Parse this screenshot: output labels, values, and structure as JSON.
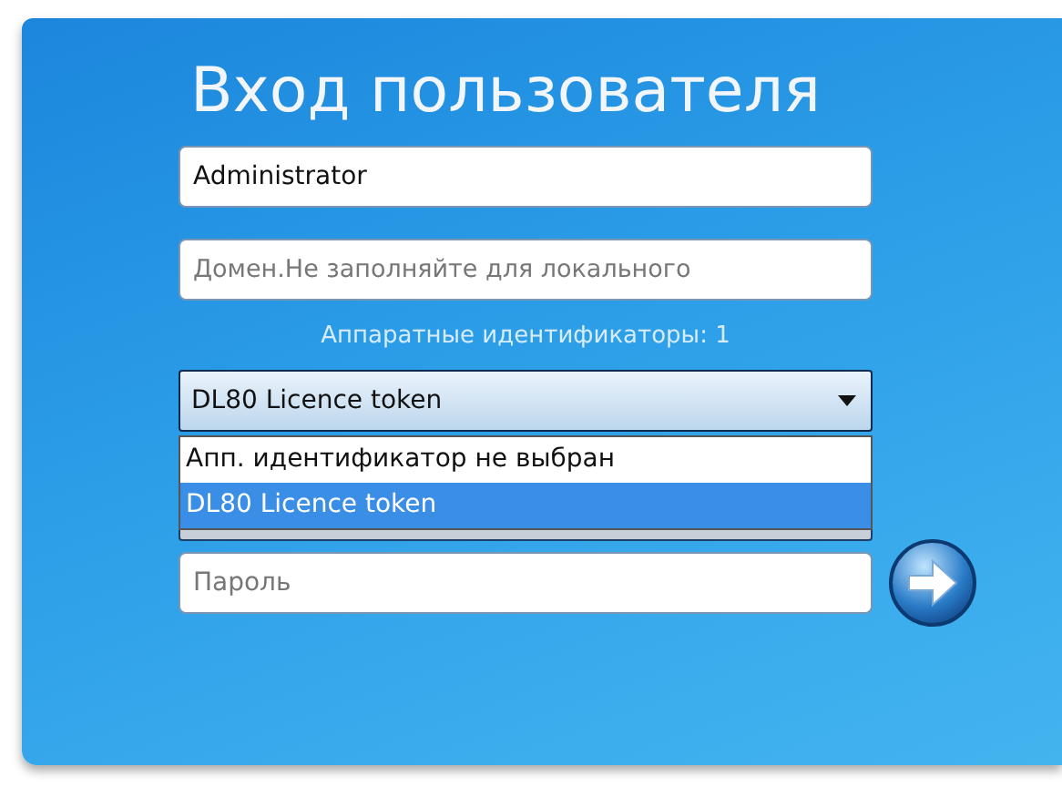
{
  "title": "Вход пользователя",
  "username": {
    "value": "Administrator"
  },
  "domain": {
    "placeholder": "Домен.Не заполняйте для локального"
  },
  "hardware_ids_label": "Аппаратные идентификаторы: 1",
  "token_dropdown": {
    "value": "DL80 Licence token",
    "expanded": true,
    "options": [
      {
        "label": "Апп. идентификатор не выбран",
        "selected": false
      },
      {
        "label": "DL80 Licence token",
        "selected": true
      }
    ]
  },
  "password": {
    "placeholder": "Пароль"
  }
}
